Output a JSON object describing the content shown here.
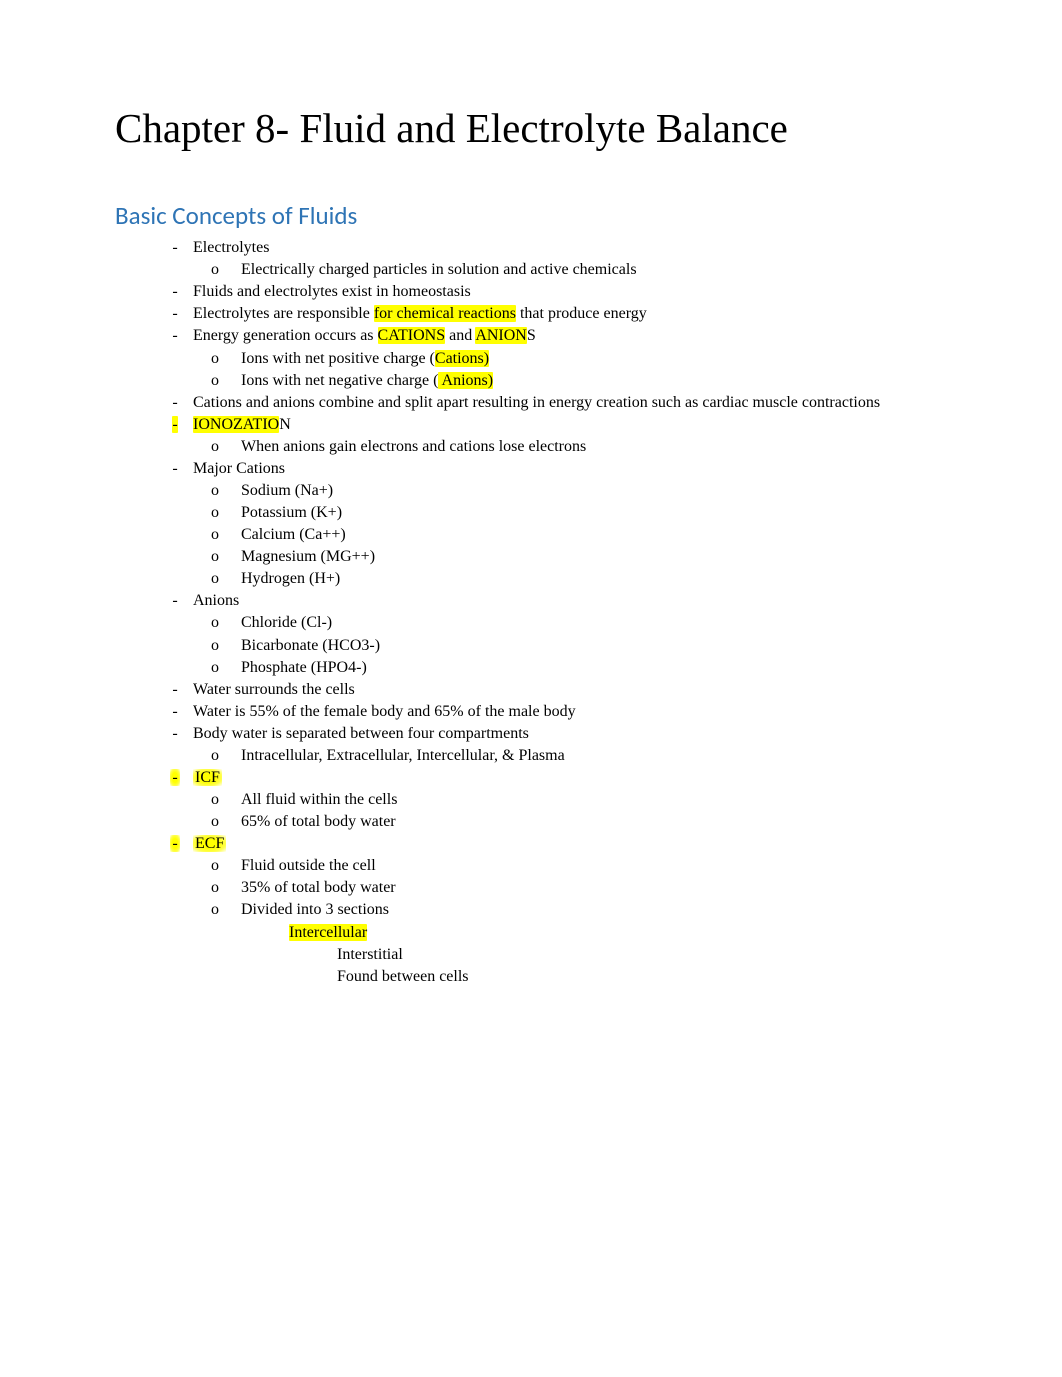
{
  "title": "Chapter 8- Fluid and Electrolyte Balance",
  "sectionHeading": "Basic Concepts of Fluids",
  "bullets": {
    "electrolytes": "Electrolytes",
    "electrolytes_sub": "Electrically charged particles in solution and active chemicals",
    "homeostasis": "Fluids and electrolytes exist in homeostasis",
    "responsible_pre": "Electrolytes are responsible ",
    "responsible_hl": "for chemical reactions",
    "responsible_post": " that produce energy",
    "energy_pre": "Energy generation occurs as ",
    "energy_cations": "CATIONS",
    "energy_and": " and ",
    "energy_anion_hl": "ANION",
    "energy_anion_s": "S",
    "ions_pos_pre": "Ions with net positive charge (",
    "ions_pos_hl": "Cations)",
    "ions_neg_pre": "Ions with net negative charge (",
    "ions_neg_hl": " Anions)",
    "combine": "Cations and anions combine and split apart resulting in energy creation such as cardiac muscle contractions",
    "ionization_hl": "IONOZATIO",
    "ionization_n": "N",
    "ionization_sub": "When anions gain electrons and cations lose electrons",
    "major_cations": "Major Cations",
    "cation_na": "Sodium (Na+)",
    "cation_k": "Potassium (K+)",
    "cation_ca": "Calcium (Ca++)",
    "cation_mg": "Magnesium (MG++)",
    "cation_h": "Hydrogen (H+)",
    "anions": "Anions",
    "anion_cl": "Chloride (Cl-)",
    "anion_hco3": "Bicarbonate (HCO3-)",
    "anion_hpo4": "Phosphate (HPO4-)",
    "water_surrounds": "Water surrounds the cells",
    "water_pct": "Water is 55% of the female body and 65% of the male body",
    "body_water_4": "Body water is separated between four compartments",
    "compartments": "Intracellular, Extracellular, Intercellular, & Plasma",
    "icf": "ICF",
    "icf_1": "All fluid within the cells",
    "icf_2": "65% of total body water",
    "ecf": "ECF",
    "ecf_1": "Fluid outside the cell",
    "ecf_2": "35% of total body water",
    "ecf_3": "Divided into 3 sections",
    "intercellular": "Intercellular",
    "interstitial": "Interstitial",
    "found_between": "Found between cells"
  },
  "markers": {
    "dash": "-",
    "o": "o",
    "square": "",
    "bullet": ""
  }
}
